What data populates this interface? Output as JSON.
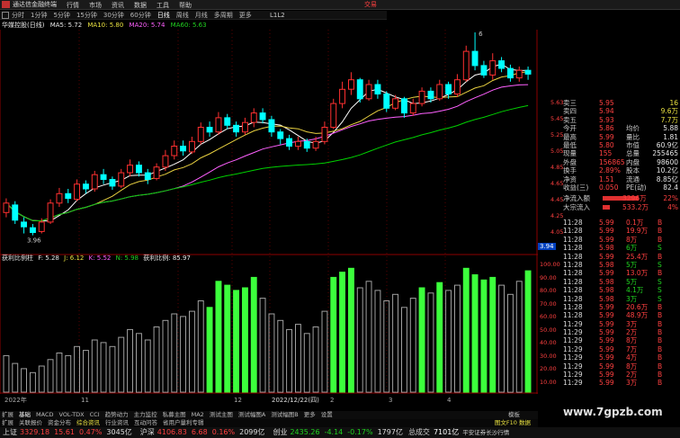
{
  "colors": {
    "up": "#ff3030",
    "down": "#00ffff",
    "ma5": "#ffffff",
    "ma10": "#e8d040",
    "ma20": "#ff60ff",
    "ma60": "#00d000",
    "ind_green": "#3cff3c",
    "ind_gray": "#a0a0a0",
    "accent": "#ff4040"
  },
  "window": {
    "title": "通达信金融终端",
    "broker": "交易"
  },
  "menu": [
    "行情",
    "市场",
    "资讯",
    "数据",
    "工具",
    "帮助"
  ],
  "periods": [
    "分时",
    "1分钟",
    "5分钟",
    "15分钟",
    "30分钟",
    "60分钟",
    "日线",
    "周线",
    "月线",
    "多周期",
    "更多"
  ],
  "l1l2": "L1L2",
  "legend": {
    "name": "华媒控股(日线)",
    "ma5": "MA5: 5.72",
    "ma10": "MA10: 5.80",
    "ma20": "MA20: 5.74",
    "ma60": "MA60: 5.63"
  },
  "indicator_legend": {
    "name": "获利比例柱",
    "f": "F: 5.28",
    "j": "J: 6.12",
    "k": "K: 5.52",
    "n": "N: 5.98",
    "ratio": "获利比例: 85.97"
  },
  "price_axis": [
    "5.63",
    "5.45",
    "5.25",
    "5.05",
    "4.85",
    "4.65",
    "4.45",
    "4.25",
    "4.05"
  ],
  "low_label": "3.96",
  "high_label": "6",
  "last_tag": "3.94",
  "ind_axis": [
    "100.00",
    "90.00",
    "80.00",
    "70.00",
    "60.00",
    "50.00",
    "40.00",
    "30.00",
    "20.00",
    "10.00"
  ],
  "date_labels": [
    "2022年",
    "11",
    "12",
    "2022/12/22(四)",
    "2",
    "3",
    "4"
  ],
  "quotes": {
    "rows": [
      {
        "l": "卖三",
        "p": "5.95",
        "v": "16"
      },
      {
        "l": "卖四",
        "p": "5.94",
        "v": "9.6万"
      },
      {
        "l": "卖五",
        "p": "5.93",
        "v": "7.7万"
      }
    ],
    "stats": [
      {
        "a": "今开",
        "b": "5.86",
        "c": "均价",
        "d": "5.88"
      },
      {
        "a": "最高",
        "b": "5.99",
        "c": "量比",
        "d": "1.81"
      },
      {
        "a": "最低",
        "b": "5.80",
        "c": "市值",
        "d": "60.9亿"
      },
      {
        "a": "现量",
        "b": "155",
        "c": "总量",
        "d": "255465"
      },
      {
        "a": "外盘",
        "b": "156865",
        "c": "内盘",
        "d": "98600"
      },
      {
        "a": "换手",
        "b": "2.89%",
        "c": "股本",
        "d": "10.2亿"
      },
      {
        "a": "净资",
        "b": "1.51",
        "c": "流通",
        "d": "8.85亿"
      },
      {
        "a": "收益(三)",
        "b": "0.050",
        "c": "PE(动)",
        "d": "82.4"
      }
    ],
    "flows": [
      {
        "a": "净流入额",
        "b": "3296万",
        "c": "22%"
      },
      {
        "a": "大宗流入",
        "b": "533.2万",
        "c": "4%"
      }
    ]
  },
  "ticks": [
    {
      "t": "11:28",
      "p": "5.99",
      "v": "0.1万",
      "s": "B"
    },
    {
      "t": "11:28",
      "p": "5.99",
      "v": "19.9万",
      "s": "B"
    },
    {
      "t": "11:28",
      "p": "5.99",
      "v": "8万",
      "s": "B"
    },
    {
      "t": "11:28",
      "p": "5.98",
      "v": "6万",
      "s": "S"
    },
    {
      "t": "11:28",
      "p": "5.99",
      "v": "25.4万",
      "s": "B"
    },
    {
      "t": "11:28",
      "p": "5.98",
      "v": "5万",
      "s": "S"
    },
    {
      "t": "11:28",
      "p": "5.99",
      "v": "13.0万",
      "s": "B"
    },
    {
      "t": "11:28",
      "p": "5.98",
      "v": "5万",
      "s": "S"
    },
    {
      "t": "11:28",
      "p": "5.98",
      "v": "4.1万",
      "s": "S"
    },
    {
      "t": "11:28",
      "p": "5.98",
      "v": "3万",
      "s": "S"
    },
    {
      "t": "11:28",
      "p": "5.99",
      "v": "20.6万",
      "s": "B"
    },
    {
      "t": "11:28",
      "p": "5.99",
      "v": "48.9万",
      "s": "B"
    },
    {
      "t": "11:29",
      "p": "5.99",
      "v": "3万",
      "s": "B"
    },
    {
      "t": "11:29",
      "p": "5.99",
      "v": "2万",
      "s": "B"
    },
    {
      "t": "11:29",
      "p": "5.99",
      "v": "8万",
      "s": "B"
    },
    {
      "t": "11:29",
      "p": "5.99",
      "v": "7万",
      "s": "B"
    },
    {
      "t": "11:29",
      "p": "5.99",
      "v": "4万",
      "s": "B"
    },
    {
      "t": "11:29",
      "p": "5.99",
      "v": "8万",
      "s": "B"
    },
    {
      "t": "11:29",
      "p": "5.99",
      "v": "2万",
      "s": "B"
    },
    {
      "t": "11:29",
      "p": "5.99",
      "v": "3万",
      "s": "B"
    }
  ],
  "tabs1": [
    "扩展",
    "基础",
    "MACD",
    "VOL-TDX",
    "CCI",
    "趋势动力",
    "主力监控",
    "私募主图",
    "MA2",
    "测试主图",
    "测试幅图A",
    "测试幅图B",
    "更多",
    "设置"
  ],
  "tabs1_right": "模板",
  "tabs2": [
    "扩展",
    "关联报价",
    "资金分布",
    "综合资讯",
    "行业资讯",
    "互动问答",
    "省用户量利专辑"
  ],
  "tabs2_right": "图文F10 数据",
  "ticker": [
    {
      "n": "上证",
      "v": "3329.18",
      "c": "15.61",
      "p": "0.47%",
      "a": "3045亿"
    },
    {
      "n": "沪深",
      "v": "4106.83",
      "c": "6.68",
      "p": "0.16%",
      "a": "2099亿"
    },
    {
      "n": "创业",
      "v": "2435.26",
      "c": "-4.14",
      "p": "-0.17%",
      "a": "1797亿"
    }
  ],
  "ticker_tail": [
    "总成交",
    "7101亿",
    "平安证券长沙行情"
  ],
  "watermark": "www.7gpzb.com",
  "chart_data": {
    "type": "candlestick",
    "ylim": [
      3.9,
      6.1
    ],
    "candles": [
      [
        4.2,
        4.3,
        4.15,
        4.35
      ],
      [
        4.28,
        4.12,
        4.08,
        4.32
      ],
      [
        4.1,
        4.05,
        3.98,
        4.15
      ],
      [
        4.04,
        3.99,
        3.96,
        4.08
      ],
      [
        4.0,
        4.1,
        3.98,
        4.14
      ],
      [
        4.1,
        4.3,
        4.08,
        4.34
      ],
      [
        4.3,
        4.4,
        4.26,
        4.46
      ],
      [
        4.4,
        4.35,
        4.3,
        4.45
      ],
      [
        4.34,
        4.5,
        4.32,
        4.55
      ],
      [
        4.5,
        4.45,
        4.4,
        4.54
      ],
      [
        4.45,
        4.6,
        4.42,
        4.64
      ],
      [
        4.6,
        4.55,
        4.5,
        4.66
      ],
      [
        4.55,
        4.48,
        4.44,
        4.58
      ],
      [
        4.48,
        4.62,
        4.46,
        4.66
      ],
      [
        4.62,
        4.7,
        4.58,
        4.76
      ],
      [
        4.7,
        4.62,
        4.58,
        4.74
      ],
      [
        4.62,
        4.55,
        4.5,
        4.66
      ],
      [
        4.56,
        4.68,
        4.54,
        4.72
      ],
      [
        4.68,
        4.8,
        4.64,
        4.86
      ],
      [
        4.8,
        4.9,
        4.76,
        4.96
      ],
      [
        4.9,
        4.85,
        4.8,
        4.96
      ],
      [
        4.84,
        4.95,
        4.82,
        5.0
      ],
      [
        4.95,
        5.1,
        4.92,
        5.15
      ],
      [
        5.1,
        5.05,
        5.0,
        5.16
      ],
      [
        5.05,
        5.2,
        5.02,
        5.26
      ],
      [
        5.2,
        5.12,
        5.08,
        5.24
      ],
      [
        5.12,
        5.05,
        5.0,
        5.16
      ],
      [
        5.05,
        5.15,
        5.02,
        5.2
      ],
      [
        5.15,
        5.25,
        5.1,
        5.3
      ],
      [
        5.25,
        5.18,
        5.14,
        5.3
      ],
      [
        5.18,
        5.05,
        5.0,
        5.22
      ],
      [
        5.05,
        4.98,
        4.92,
        5.08
      ],
      [
        4.98,
        4.9,
        4.86,
        5.02
      ],
      [
        4.9,
        4.95,
        4.86,
        5.0
      ],
      [
        4.95,
        4.88,
        4.84,
        4.98
      ],
      [
        4.88,
        4.95,
        4.85,
        5.0
      ],
      [
        4.95,
        5.1,
        4.92,
        5.16
      ],
      [
        5.1,
        5.35,
        5.08,
        5.4
      ],
      [
        5.35,
        5.5,
        5.3,
        5.58
      ],
      [
        5.5,
        5.6,
        5.44,
        5.68
      ],
      [
        5.6,
        5.4,
        5.36,
        5.62
      ],
      [
        5.4,
        5.55,
        5.38,
        5.6
      ],
      [
        5.55,
        5.45,
        5.4,
        5.6
      ],
      [
        5.45,
        5.3,
        5.26,
        5.48
      ],
      [
        5.3,
        5.4,
        5.28,
        5.44
      ],
      [
        5.4,
        5.25,
        5.2,
        5.42
      ],
      [
        5.25,
        5.35,
        5.22,
        5.4
      ],
      [
        5.35,
        5.48,
        5.32,
        5.52
      ],
      [
        5.48,
        5.4,
        5.36,
        5.52
      ],
      [
        5.4,
        5.55,
        5.38,
        5.6
      ],
      [
        5.55,
        5.45,
        5.4,
        5.58
      ],
      [
        5.45,
        5.6,
        5.42,
        5.66
      ],
      [
        5.6,
        5.9,
        5.58,
        5.96
      ],
      [
        5.9,
        5.75,
        5.7,
        6.1
      ],
      [
        5.75,
        5.65,
        5.62,
        5.8
      ],
      [
        5.65,
        5.8,
        5.6,
        5.88
      ],
      [
        5.8,
        5.72,
        5.68,
        5.84
      ],
      [
        5.72,
        5.62,
        5.58,
        5.76
      ],
      [
        5.62,
        5.7,
        5.58,
        5.74
      ],
      [
        5.7,
        5.66,
        5.6,
        5.74
      ]
    ],
    "ind_values": [
      28,
      22,
      18,
      15,
      20,
      25,
      30,
      28,
      35,
      32,
      40,
      38,
      35,
      42,
      48,
      45,
      40,
      50,
      55,
      60,
      58,
      62,
      70,
      65,
      85,
      82,
      78,
      80,
      88,
      72,
      60,
      55,
      48,
      52,
      45,
      50,
      62,
      88,
      92,
      95,
      80,
      85,
      78,
      70,
      75,
      65,
      72,
      80,
      76,
      84,
      78,
      82,
      95,
      90,
      86,
      88,
      82,
      75,
      85,
      93
    ],
    "ind_green": [
      false,
      false,
      false,
      false,
      false,
      false,
      false,
      false,
      false,
      false,
      false,
      false,
      false,
      false,
      false,
      false,
      false,
      false,
      false,
      false,
      false,
      false,
      false,
      true,
      true,
      true,
      true,
      true,
      true,
      false,
      false,
      false,
      false,
      false,
      false,
      false,
      false,
      true,
      true,
      true,
      false,
      false,
      false,
      false,
      false,
      false,
      false,
      true,
      false,
      true,
      false,
      false,
      true,
      true,
      true,
      true,
      false,
      false,
      false,
      true
    ]
  }
}
